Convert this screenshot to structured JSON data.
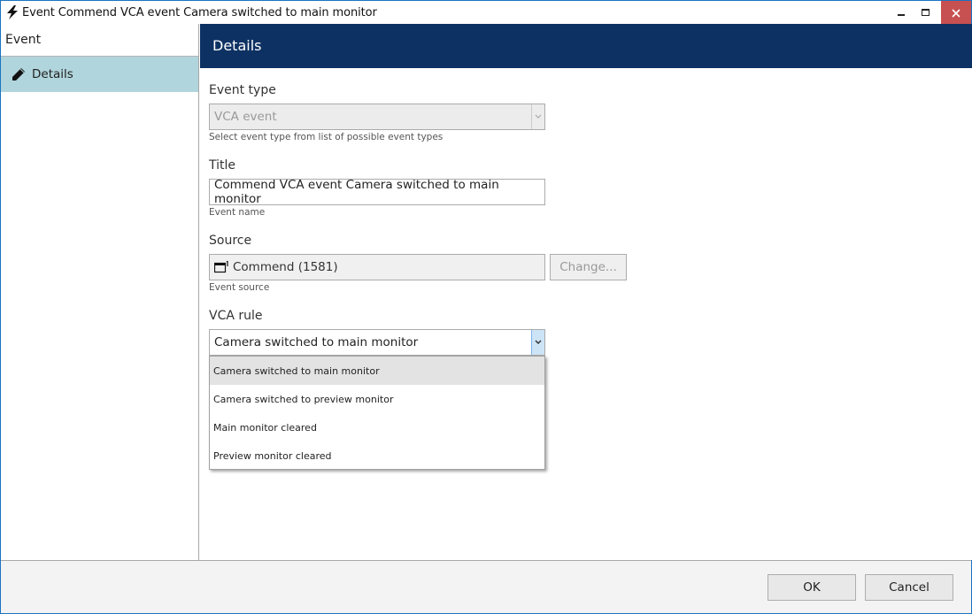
{
  "window": {
    "title": "Event Commend VCA event Camera switched to main monitor",
    "app_icon": "lightning-icon",
    "controls": [
      "minimize-icon",
      "maximize-icon",
      "close-icon"
    ]
  },
  "sidebar": {
    "heading": "Event",
    "items": [
      {
        "label": "Details",
        "icon": "pencil-icon",
        "selected": true
      }
    ]
  },
  "main": {
    "header": "Details",
    "event_type": {
      "label": "Event type",
      "value": "VCA event",
      "hint": "Select event type from list of possible event types",
      "disabled": true
    },
    "title_field": {
      "label": "Title",
      "value": "Commend VCA event Camera switched to main monitor",
      "hint": "Event name"
    },
    "source": {
      "label": "Source",
      "value": "Commend (1581)",
      "icon": "device-icon",
      "hint": "Event source",
      "change_button": "Change..."
    },
    "vca_rule": {
      "label": "VCA rule",
      "value": "Camera switched to main monitor",
      "options": [
        "Camera switched to main monitor",
        "Camera switched to preview monitor",
        "Main monitor cleared",
        "Preview monitor cleared"
      ],
      "highlighted_index": 0
    }
  },
  "footer": {
    "ok_label": "OK",
    "cancel_label": "Cancel"
  },
  "colors": {
    "header_bg": "#0e3163",
    "sidebar_selected": "#b0d5dc",
    "close_button": "#c75050",
    "window_border": "#1a73c2"
  }
}
